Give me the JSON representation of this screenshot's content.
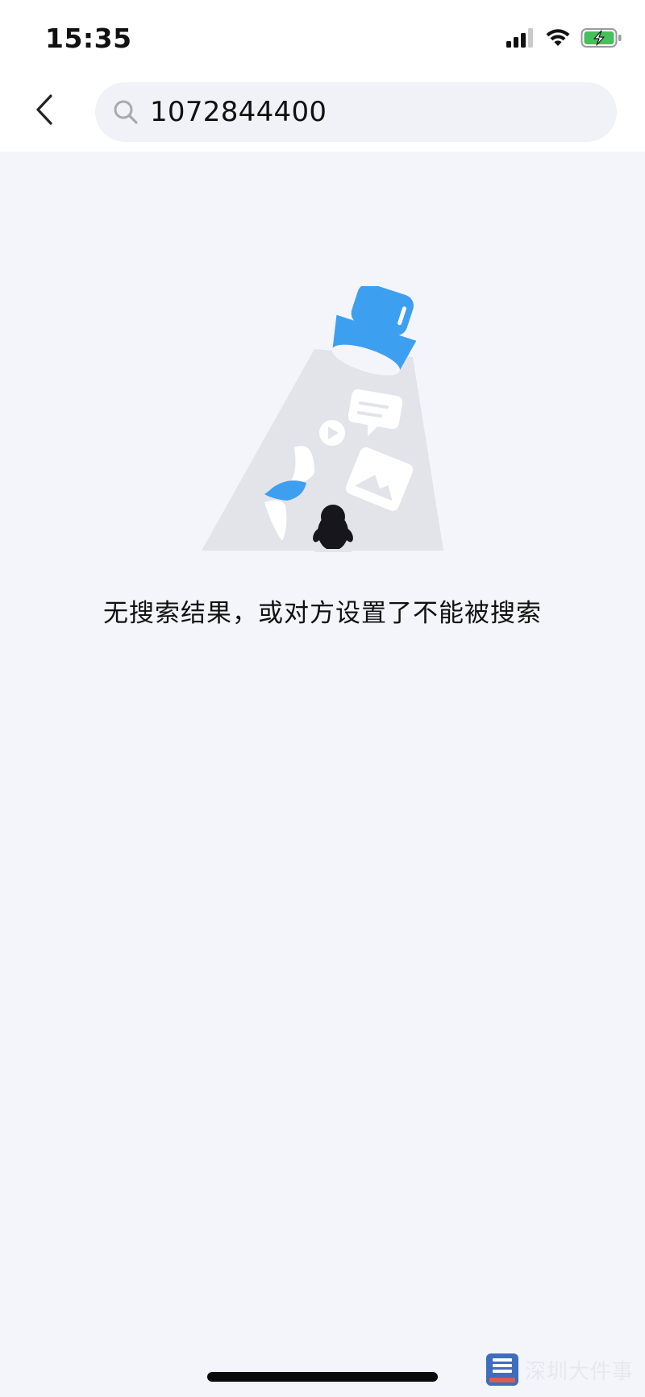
{
  "status_bar": {
    "time": "15:35",
    "signal_icon": "cellular-signal-icon",
    "wifi_icon": "wifi-icon",
    "battery_icon": "battery-charging-icon"
  },
  "header": {
    "back_icon": "chevron-left-icon",
    "search": {
      "icon": "search-icon",
      "value": "1072844400"
    }
  },
  "empty_state": {
    "illustration": "flashlight-no-results-illustration",
    "message": "无搜索结果，或对方设置了不能被搜索"
  },
  "watermark": {
    "logo_text": "深圳大件事",
    "text": "深圳大件事"
  },
  "colors": {
    "accent": "#3d9ff0",
    "background": "#f4f5fa",
    "header_background": "#ffffff",
    "search_background": "#f1f2f7"
  }
}
